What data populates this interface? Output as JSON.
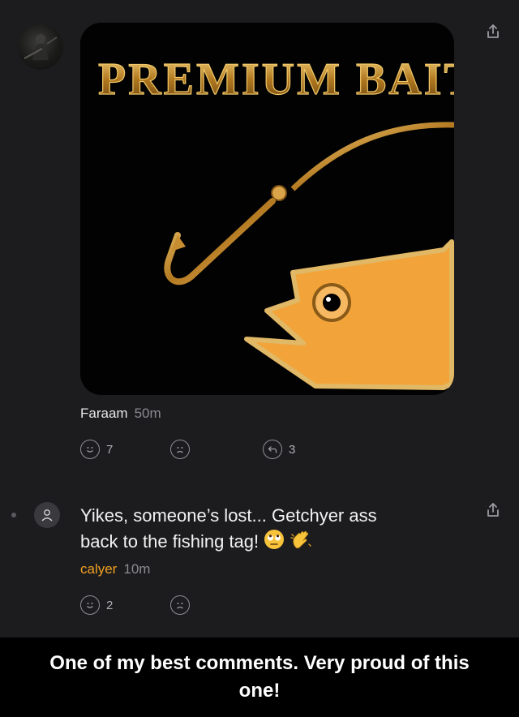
{
  "post": {
    "image_text": "PREMIUM BAIT.",
    "author": "Faraam",
    "time": "50m",
    "likes": "7",
    "replies": "3"
  },
  "comment": {
    "text_line1": "Yikes, someone’s lost... Getchyer ass",
    "text_line2": "back to the fishing tag!",
    "emojis": [
      "eye-roll-emoji",
      "waving-hand-emoji"
    ],
    "author": "calyer",
    "time": "10m",
    "likes": "2"
  },
  "caption": "One of my best comments. Very proud of this one!",
  "colors": {
    "background": "#1c1c1f",
    "orange": "#f0a020",
    "gold": "#c8902c"
  }
}
